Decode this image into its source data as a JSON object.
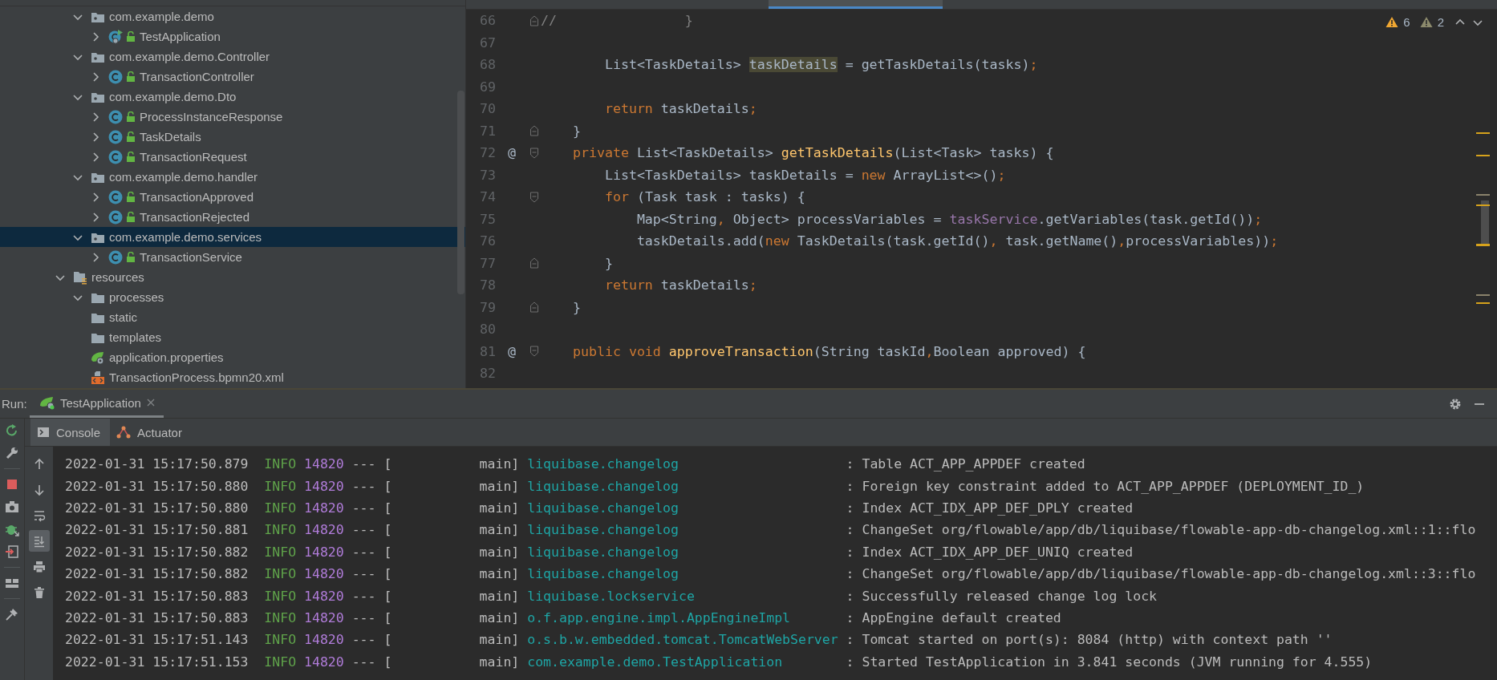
{
  "project_tree": {
    "nested_items": [
      {
        "label": "com.example.demo",
        "kind": "package",
        "expanded": true,
        "selected": false,
        "children": [
          {
            "label": "TestApplication",
            "kind": "main_class",
            "expanded": false,
            "selected": false
          }
        ]
      },
      {
        "label": "com.example.demo.Controller",
        "kind": "package",
        "expanded": true,
        "selected": false,
        "children": [
          {
            "label": "TransactionController",
            "kind": "class",
            "expanded": false,
            "selected": false
          }
        ]
      },
      {
        "label": "com.example.demo.Dto",
        "kind": "package",
        "expanded": true,
        "selected": false,
        "children": [
          {
            "label": "ProcessInstanceResponse",
            "kind": "class",
            "expanded": false,
            "selected": false
          },
          {
            "label": "TaskDetails",
            "kind": "class",
            "expanded": false,
            "selected": false
          },
          {
            "label": "TransactionRequest",
            "kind": "class",
            "expanded": false,
            "selected": false
          }
        ]
      },
      {
        "label": "com.example.demo.handler",
        "kind": "package",
        "expanded": true,
        "selected": false,
        "children": [
          {
            "label": "TransactionApproved",
            "kind": "class",
            "expanded": false,
            "selected": false
          },
          {
            "label": "TransactionRejected",
            "kind": "class",
            "expanded": false,
            "selected": false
          }
        ]
      },
      {
        "label": "com.example.demo.services",
        "kind": "package",
        "expanded": true,
        "selected": true,
        "children": [
          {
            "label": "TransactionService",
            "kind": "class",
            "expanded": false,
            "selected": false
          }
        ]
      }
    ],
    "items": [
      {
        "label": "resources",
        "kind": "resources_folder",
        "expanded": true,
        "selected": false,
        "children": [
          {
            "label": "processes",
            "kind": "folder",
            "expanded": true,
            "selected": false
          },
          {
            "label": "static",
            "kind": "folder",
            "selected": false
          },
          {
            "label": "templates",
            "kind": "folder",
            "selected": false
          },
          {
            "label": "application.properties",
            "kind": "properties",
            "selected": false
          },
          {
            "label": "TransactionProcess.bpmn20.xml",
            "kind": "xml",
            "selected": false
          }
        ]
      }
    ]
  },
  "editor": {
    "inspections": {
      "warnings": "6",
      "weak_warnings": "2"
    },
    "lines": [
      {
        "number": "66",
        "kind": "fold_end",
        "tokens": [
          {
            "kind": "comment",
            "text": "//                }"
          }
        ]
      },
      {
        "number": "67",
        "kind": "plain"
      },
      {
        "number": "68",
        "kind": "plain",
        "tokens": [
          {
            "kind": "plain",
            "text": "        List<TaskDetails> "
          },
          {
            "kind": "usage",
            "text": "taskDetails"
          },
          {
            "kind": "plain",
            "text": " = getTaskDetails(tasks)"
          },
          {
            "kind": "punct",
            "text": ";"
          }
        ]
      },
      {
        "number": "69",
        "kind": "plain"
      },
      {
        "number": "70",
        "kind": "plain",
        "tokens": [
          {
            "kind": "keyword",
            "text": "        return"
          },
          {
            "kind": "plain",
            "text": " taskDetails"
          },
          {
            "kind": "punct",
            "text": ";"
          }
        ]
      },
      {
        "number": "71",
        "kind": "fold_end",
        "tokens": [
          {
            "kind": "plain",
            "text": "    }"
          }
        ]
      },
      {
        "number": "72",
        "marker": "@",
        "kind": "fold_start",
        "tokens": [
          {
            "kind": "keyword",
            "text": "    private"
          },
          {
            "kind": "plain",
            "text": " List<TaskDetails> "
          },
          {
            "kind": "declaration",
            "text": "getTaskDetails"
          },
          {
            "kind": "plain",
            "text": "(List<Task> tasks) {"
          }
        ]
      },
      {
        "number": "73",
        "kind": "plain",
        "tokens": [
          {
            "kind": "plain",
            "text": "        List<TaskDetails> taskDetails = "
          },
          {
            "kind": "keyword",
            "text": "new"
          },
          {
            "kind": "plain",
            "text": " ArrayList<>()"
          },
          {
            "kind": "punct",
            "text": ";"
          }
        ]
      },
      {
        "number": "74",
        "kind": "fold_start",
        "tokens": [
          {
            "kind": "keyword",
            "text": "        for"
          },
          {
            "kind": "plain",
            "text": " (Task task : tasks) {"
          }
        ]
      },
      {
        "number": "75",
        "kind": "plain",
        "tokens": [
          {
            "kind": "plain",
            "text": "            Map<String"
          },
          {
            "kind": "punct",
            "text": ","
          },
          {
            "kind": "plain",
            "text": " Object> processVariables = "
          },
          {
            "kind": "field",
            "text": "taskService"
          },
          {
            "kind": "plain",
            "text": ".getVariables(task.getId())"
          },
          {
            "kind": "punct",
            "text": ";"
          }
        ]
      },
      {
        "number": "76",
        "kind": "plain",
        "tokens": [
          {
            "kind": "plain",
            "text": "            taskDetails.add("
          },
          {
            "kind": "keyword",
            "text": "new"
          },
          {
            "kind": "plain",
            "text": " TaskDetails(task.getId()"
          },
          {
            "kind": "punct",
            "text": ","
          },
          {
            "kind": "plain",
            "text": " task.getName()"
          },
          {
            "kind": "punct",
            "text": ","
          },
          {
            "kind": "plain",
            "text": "processVariables))"
          },
          {
            "kind": "punct",
            "text": ";"
          }
        ]
      },
      {
        "number": "77",
        "kind": "fold_end",
        "tokens": [
          {
            "kind": "plain",
            "text": "        }"
          }
        ]
      },
      {
        "number": "78",
        "kind": "plain",
        "tokens": [
          {
            "kind": "keyword",
            "text": "        return"
          },
          {
            "kind": "plain",
            "text": " taskDetails"
          },
          {
            "kind": "punct",
            "text": ";"
          }
        ]
      },
      {
        "number": "79",
        "kind": "fold_end",
        "tokens": [
          {
            "kind": "plain",
            "text": "    }"
          }
        ]
      },
      {
        "number": "80",
        "kind": "plain"
      },
      {
        "number": "81",
        "marker": "@",
        "kind": "fold_start",
        "tokens": [
          {
            "kind": "keyword",
            "text": "    public void"
          },
          {
            "kind": "declaration",
            "text": " approveTransaction"
          },
          {
            "kind": "plain",
            "text": "(String taskId"
          },
          {
            "kind": "punct",
            "text": ","
          },
          {
            "kind": "plain",
            "text": "Boolean approved) {"
          }
        ]
      },
      {
        "number": "82",
        "kind": "plain"
      }
    ]
  },
  "run_panel": {
    "label": "Run:",
    "tab": {
      "title": "TestApplication"
    },
    "tabs": [
      {
        "label": "Console",
        "kind": "console",
        "selected": true
      },
      {
        "label": "Actuator",
        "kind": "actuator",
        "selected": false
      }
    ],
    "console_tools": [
      {
        "kind": "up",
        "selected": false
      },
      {
        "kind": "down",
        "selected": false
      },
      {
        "kind": "wrap",
        "selected": false
      },
      {
        "kind": "scroll_end",
        "selected": true
      },
      {
        "kind": "print",
        "selected": false
      },
      {
        "kind": "clear",
        "selected": false
      }
    ],
    "log_lines": [
      {
        "timestamp": "2022-01-31 15:17:50.879",
        "level": "INFO",
        "pid": "14820",
        "separator": "---",
        "thread": "[           main]",
        "logger": "liquibase.changelog",
        "message": ": Table ACT_APP_APPDEF created"
      },
      {
        "timestamp": "2022-01-31 15:17:50.880",
        "level": "INFO",
        "pid": "14820",
        "separator": "---",
        "thread": "[           main]",
        "logger": "liquibase.changelog",
        "message": ": Foreign key constraint added to ACT_APP_APPDEF (DEPLOYMENT_ID_)"
      },
      {
        "timestamp": "2022-01-31 15:17:50.880",
        "level": "INFO",
        "pid": "14820",
        "separator": "---",
        "thread": "[           main]",
        "logger": "liquibase.changelog",
        "message": ": Index ACT_IDX_APP_DEF_DPLY created"
      },
      {
        "timestamp": "2022-01-31 15:17:50.881",
        "level": "INFO",
        "pid": "14820",
        "separator": "---",
        "thread": "[           main]",
        "logger": "liquibase.changelog",
        "message": ": ChangeSet org/flowable/app/db/liquibase/flowable-app-db-changelog.xml::1::flo"
      },
      {
        "timestamp": "2022-01-31 15:17:50.882",
        "level": "INFO",
        "pid": "14820",
        "separator": "---",
        "thread": "[           main]",
        "logger": "liquibase.changelog",
        "message": ": Index ACT_IDX_APP_DEF_UNIQ created"
      },
      {
        "timestamp": "2022-01-31 15:17:50.882",
        "level": "INFO",
        "pid": "14820",
        "separator": "---",
        "thread": "[           main]",
        "logger": "liquibase.changelog",
        "message": ": ChangeSet org/flowable/app/db/liquibase/flowable-app-db-changelog.xml::3::flo"
      },
      {
        "timestamp": "2022-01-31 15:17:50.883",
        "level": "INFO",
        "pid": "14820",
        "separator": "---",
        "thread": "[           main]",
        "logger": "liquibase.lockservice",
        "message": ": Successfully released change log lock"
      },
      {
        "timestamp": "2022-01-31 15:17:50.883",
        "level": "INFO",
        "pid": "14820",
        "separator": "---",
        "thread": "[           main]",
        "logger": "o.f.app.engine.impl.AppEngineImpl",
        "message": ": AppEngine default created"
      },
      {
        "timestamp": "2022-01-31 15:17:51.143",
        "level": "INFO",
        "pid": "14820",
        "separator": "---",
        "thread": "[           main]",
        "logger": "o.s.b.w.embedded.tomcat.TomcatWebServer",
        "message": ": Tomcat started on port(s): 8084 (http) with context path ''"
      },
      {
        "timestamp": "2022-01-31 15:17:51.153",
        "level": "INFO",
        "pid": "14820",
        "separator": "---",
        "thread": "[           main]",
        "logger": "com.example.demo.TestApplication",
        "message": ": Started TestApplication in 3.841 seconds (JVM running for 4.555)"
      }
    ]
  }
}
